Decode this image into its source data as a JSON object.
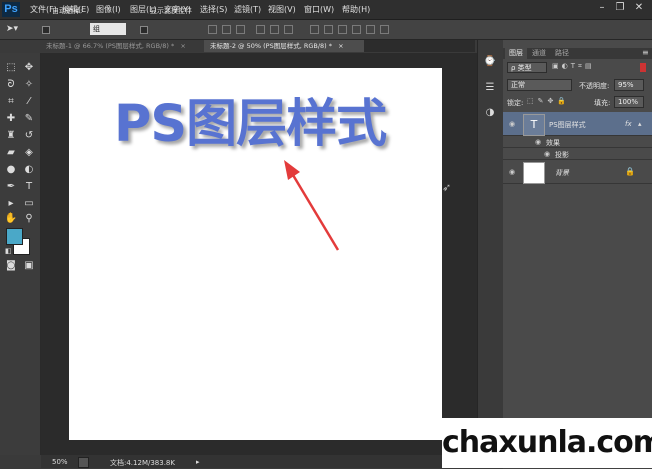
{
  "app": {
    "logo": "Ps"
  },
  "menu": [
    "文件(F)",
    "编辑(E)",
    "图像(I)",
    "图层(L)",
    "文字(Y)",
    "选择(S)",
    "滤镜(T)",
    "视图(V)",
    "窗口(W)",
    "帮助(H)"
  ],
  "window_controls": {
    "minimize": "–",
    "restore": "❐",
    "close": "✕"
  },
  "options_bar": {
    "auto_select_label": "自动选择:",
    "auto_select_value": "组",
    "show_transform_label": "显示变换控件"
  },
  "tabs": [
    {
      "label": "未标题-1 @ 66.7% (PS图层样式, RGB/8) *",
      "close": "×",
      "active": false
    },
    {
      "label": "未标题-2 @ 50% (PS图层样式, RGB/8) *",
      "close": "×",
      "active": true
    }
  ],
  "canvas": {
    "headline": "PS图层样式",
    "headline_color": "#5873d1"
  },
  "arrow_color": "#e33b3b",
  "status": {
    "zoom": "50%",
    "doc_info": "文档:4.12M/383.8K"
  },
  "colors": {
    "foreground": "#4aa8c8",
    "background": "#ffffff"
  },
  "layers_panel": {
    "tabs": [
      "图层",
      "通道",
      "路径"
    ],
    "kind_filter": "ρ 类型",
    "blend_mode": "正常",
    "opacity_label": "不透明度:",
    "opacity_value": "95%",
    "lock_label": "锁定:",
    "fill_label": "填充:",
    "fill_value": "100%",
    "layers": [
      {
        "name": "PS图层样式",
        "type": "text",
        "thumb": "T",
        "fx": "fx",
        "effects_label": "效果",
        "effects": [
          "投影"
        ]
      },
      {
        "name": "背景",
        "type": "background",
        "locked": true
      }
    ]
  },
  "watermark": "chaxunla.com"
}
